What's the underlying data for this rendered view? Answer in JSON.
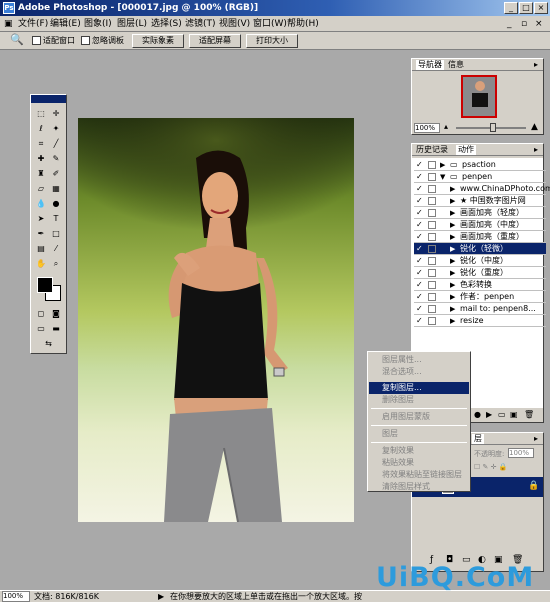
{
  "window": {
    "title": "Adobe Photoshop - [000017.jpg @ 100% (RGB)]"
  },
  "menu": [
    "文件(F)",
    "编辑(E)",
    "图象(I)",
    "图层(L)",
    "选择(S)",
    "滤镜(T)",
    "视图(V)",
    "窗口(W)",
    "帮助(H)"
  ],
  "options": {
    "fit_window": "适配窗口",
    "ignore_palettes": "忽略调板",
    "actual_pixels": "实际象素",
    "fit_screen": "适配屏幕",
    "print_size": "打印大小"
  },
  "navigator": {
    "tabs": [
      "导航器",
      "信息"
    ],
    "zoom": "100%"
  },
  "history_actions": {
    "tabs": [
      "历史记录",
      "动作"
    ],
    "rows": [
      {
        "check": "✓",
        "folder": true,
        "label": "psaction",
        "indent": 0,
        "expanded": false
      },
      {
        "check": "✓",
        "folder": true,
        "label": "penpen",
        "indent": 0,
        "expanded": true
      },
      {
        "check": "✓",
        "folder": false,
        "label": "www.ChinaDPhoto.com",
        "indent": 1
      },
      {
        "check": "✓",
        "folder": false,
        "label": "★ 中国数字图片网",
        "indent": 1
      },
      {
        "check": "✓",
        "folder": false,
        "label": "画面加亮（轻度）",
        "indent": 1
      },
      {
        "check": "✓",
        "folder": false,
        "label": "画面加亮（中度）",
        "indent": 1
      },
      {
        "check": "✓",
        "folder": false,
        "label": "画面加亮（重度）",
        "indent": 1
      },
      {
        "check": "✓",
        "folder": false,
        "label": "锐化（轻微）",
        "indent": 1,
        "selected": true
      },
      {
        "check": "✓",
        "folder": false,
        "label": "锐化（中度）",
        "indent": 1
      },
      {
        "check": "✓",
        "folder": false,
        "label": "锐化（重度）",
        "indent": 1
      },
      {
        "check": "✓",
        "folder": false,
        "label": "色彩转换",
        "indent": 1
      },
      {
        "check": "✓",
        "folder": false,
        "label": "作者：penpen",
        "indent": 1
      },
      {
        "check": "✓",
        "folder": false,
        "label": "mail to: penpen8...",
        "indent": 1
      },
      {
        "check": "✓",
        "folder": false,
        "label": "resize",
        "indent": 1
      }
    ]
  },
  "layers": {
    "tab": "层",
    "opacity_label": "不透明度:",
    "opacity_value": "100%"
  },
  "context_menu": [
    {
      "label": "图层属性...",
      "enabled": false
    },
    {
      "label": "混合选项...",
      "enabled": false
    },
    {
      "label": "复制图层...",
      "enabled": true,
      "highlighted": true
    },
    {
      "label": "删除图层",
      "enabled": false
    },
    {
      "label": "启用图层蒙版",
      "enabled": false
    },
    {
      "label": "图层",
      "enabled": false
    },
    {
      "label": "复制效果",
      "enabled": false
    },
    {
      "label": "粘贴效果",
      "enabled": false
    },
    {
      "label": "将效果粘贴至链接图层",
      "enabled": false
    },
    {
      "label": "清除图层样式",
      "enabled": false
    }
  ],
  "status": {
    "zoom": "100%",
    "doc": "文档: 816K/816K",
    "hint": "在你想要放大的区域上单击或在拖出一个放大区域。按"
  },
  "watermark": "UiBQ.CoM",
  "colors": {
    "title_start": "#0a246a",
    "title_end": "#a6caf0",
    "selection": "#0a246a",
    "chrome": "#d4d0c8",
    "workspace": "#a9a9a9",
    "watermark": "#2d9bdc"
  }
}
